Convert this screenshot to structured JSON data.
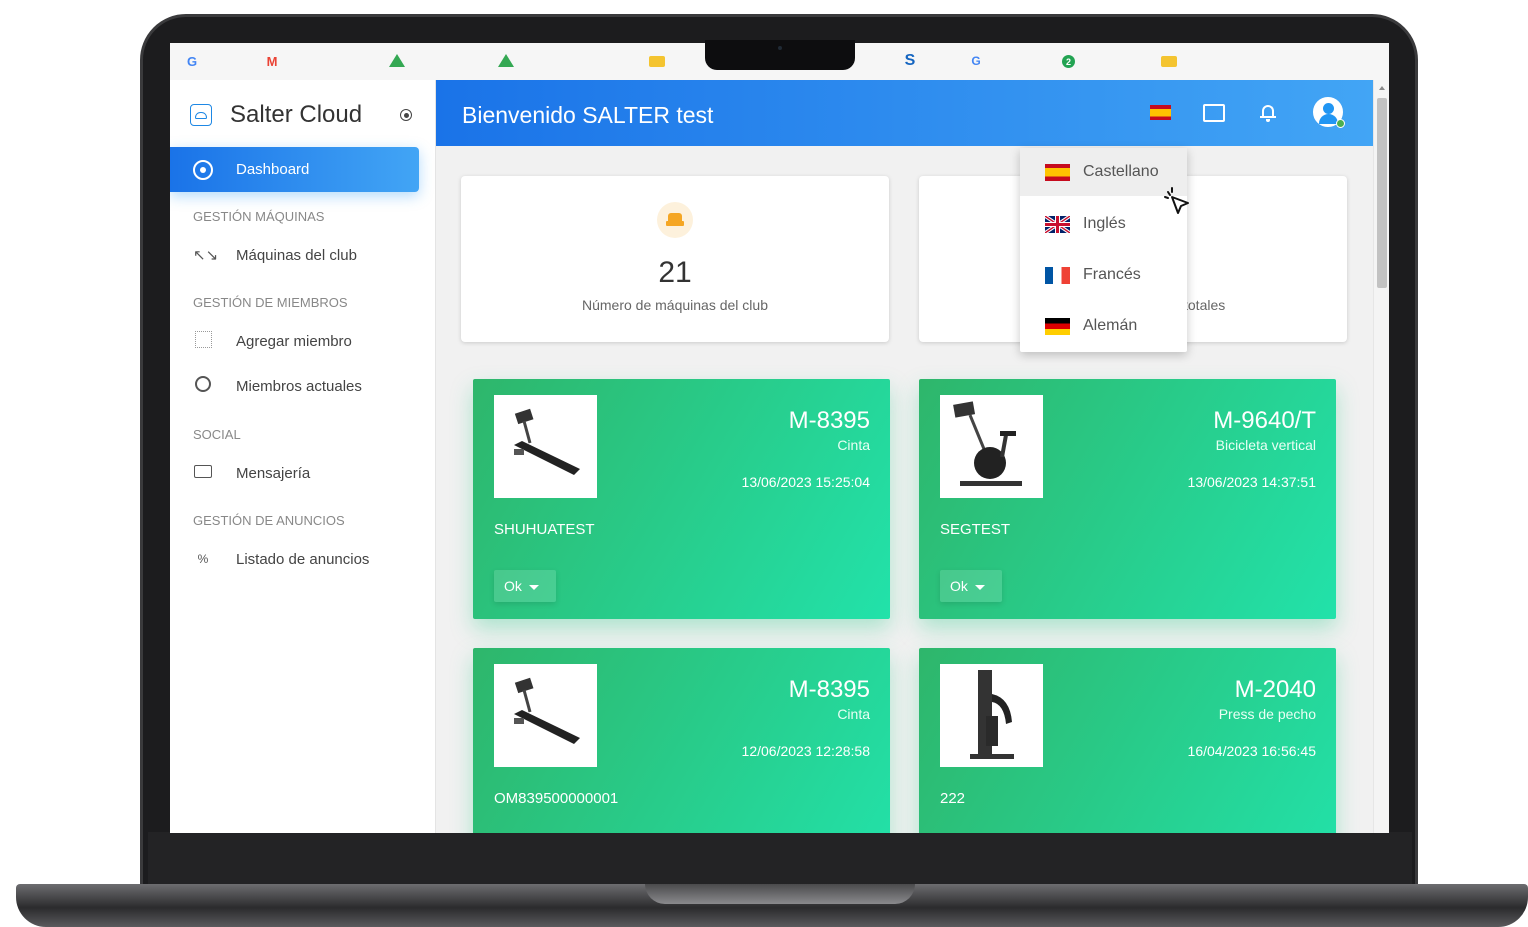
{
  "browser": {
    "bookmarks": [
      {
        "glyph": "G",
        "icon": "google-icon"
      },
      {
        "glyph": "M",
        "icon": "gmail-icon"
      },
      {
        "icon": "drive-icon"
      },
      {
        "icon": "drive-icon"
      },
      {
        "icon": "folder-icon"
      },
      {
        "glyph": "S",
        "icon": "s-app-icon"
      },
      {
        "glyph": "G",
        "icon": "translate-icon"
      },
      {
        "glyph": "2",
        "icon": "green-app-icon"
      },
      {
        "icon": "folder-icon"
      }
    ]
  },
  "sidebar": {
    "brand": "Salter Cloud",
    "active_item": "Dashboard",
    "sections": [
      {
        "title": "GESTIÓN MÁQUINAS",
        "items": [
          {
            "label": "Máquinas del club",
            "icon": "arrows-icon"
          }
        ]
      },
      {
        "title": "GESTIÓN DE MIEMBROS",
        "items": [
          {
            "label": "Agregar miembro",
            "icon": "grid-icon"
          },
          {
            "label": "Miembros actuales",
            "icon": "user-circle-icon"
          }
        ]
      },
      {
        "title": "SOCIAL",
        "items": [
          {
            "label": "Mensajería",
            "icon": "mail-icon"
          }
        ]
      },
      {
        "title": "GESTIÓN DE ANUNCIOS",
        "items": [
          {
            "label": "Listado de anuncios",
            "icon": "announcements-icon"
          }
        ]
      }
    ]
  },
  "header": {
    "title": "Bienvenido SALTER test",
    "icons": [
      "spain-flag-icon",
      "fullscreen-icon",
      "bell-icon",
      "avatar-icon"
    ]
  },
  "stats": [
    {
      "value": "21",
      "label": "Número de máquinas del club"
    },
    {
      "value": "",
      "label": "totales"
    }
  ],
  "language_menu": {
    "items": [
      "Castellano",
      "Inglés",
      "Francés",
      "Alemán"
    ],
    "selected": "Castellano"
  },
  "machines": [
    {
      "code": "M-8395",
      "type": "Cinta",
      "date": "13/06/2023 15:25:04",
      "name": "SHUHUATEST",
      "status": "Ok"
    },
    {
      "code": "M-9640/T",
      "type": "Bicicleta vertical",
      "date": "13/06/2023 14:37:51",
      "name": "SEGTEST",
      "status": "Ok"
    },
    {
      "code": "M-8395",
      "type": "Cinta",
      "date": "12/06/2023 12:28:58",
      "name": "OM839500000001",
      "status": ""
    },
    {
      "code": "M-2040",
      "type": "Press de pecho",
      "date": "16/04/2023 16:56:45",
      "name": "222",
      "status": ""
    }
  ],
  "colors": {
    "accent_blue": "#1a73e8",
    "card_green_start": "#2eb66b",
    "card_green_end": "#22e2aa",
    "stat_icon": "#f5a623"
  }
}
